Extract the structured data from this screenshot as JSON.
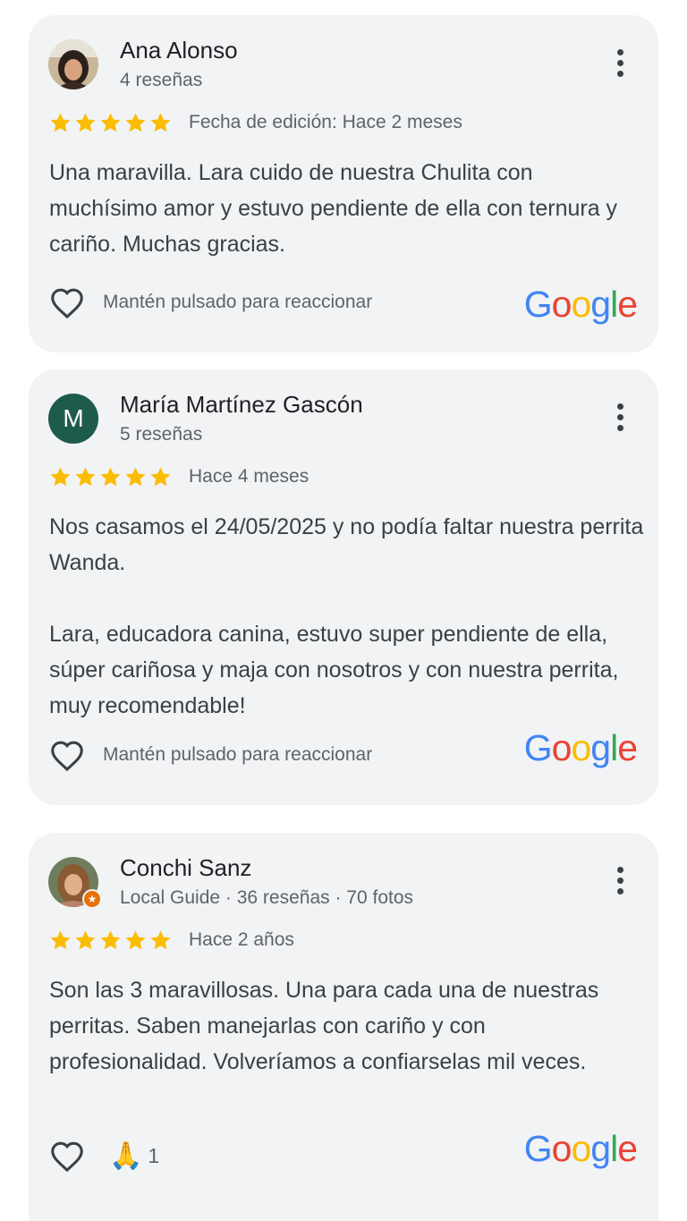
{
  "colors": {
    "star": "#fbbc04",
    "card_bg": "#f1f3f4",
    "avatar_m_bg": "#1e5b4d",
    "local_guide_badge": "#e8710a",
    "google_blue": "#4285f4",
    "google_red": "#ea4335",
    "google_yellow": "#fbbc05",
    "google_green": "#34a853"
  },
  "reviews": [
    {
      "author": "Ana Alonso",
      "meta": "4 reseñas",
      "avatar": "photo",
      "rating": 5,
      "date": "Fecha de edición: Hace 2 meses",
      "paragraphs": [
        "Una maravilla. Lara cuido de nuestra Chulita con muchísimo amor y estuvo pendiente de ella con ternura y cariño. Muchas gracias."
      ],
      "reaction_label": "Mantén pulsado para reaccionar",
      "menu_icon": "more-vert-icon",
      "like_icon": "heart-outline-icon",
      "source_logo": "Google"
    },
    {
      "author": "María Martínez Gascón",
      "meta": "5 reseñas",
      "avatar_letter": "M",
      "rating": 5,
      "date": "Hace 4 meses",
      "paragraphs": [
        "Nos casamos el 24/05/2025 y no podía faltar nuestra perrita Wanda.",
        "Lara, educadora canina, estuvo super pendiente de ella, súper cariñosa y maja con nosotros y con nuestra perrita, muy recomendable!"
      ],
      "reaction_label": "Mantén pulsado para reaccionar",
      "menu_icon": "more-vert-icon",
      "like_icon": "heart-outline-icon",
      "source_logo": "Google"
    },
    {
      "author": "Conchi Sanz",
      "meta": "Local Guide · 36 reseñas · 70 fotos",
      "avatar": "photo",
      "badge_icon": "local-guide-star-icon",
      "rating": 5,
      "date": "Hace 2 años",
      "paragraphs": [
        "Son las 3 maravillosas. Una para cada una de nuestras perritas. Saben manejarlas con cariño y con profesionalidad. Volveríamos a confiarselas mil veces."
      ],
      "reaction_emoji": "🙏",
      "reaction_count": "1",
      "menu_icon": "more-vert-icon",
      "like_icon": "heart-outline-icon",
      "source_logo": "Google"
    }
  ]
}
